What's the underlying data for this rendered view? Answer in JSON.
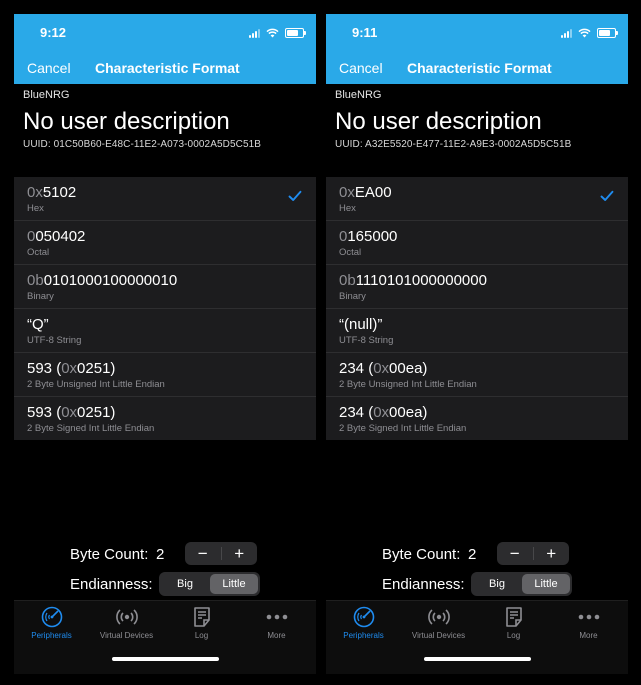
{
  "screens": [
    {
      "time": "9:12",
      "cancel": "Cancel",
      "nav_title": "Characteristic Format",
      "device": "BlueNRG",
      "description": "No user description",
      "uuid": "UUID: 01C50B60-E48C-11E2-A073-0002A5D5C51B",
      "formats": [
        {
          "prefix": "0x",
          "value": "5102",
          "label": "Hex",
          "selected": true
        },
        {
          "prefix": "0",
          "value": "050402",
          "label": "Octal"
        },
        {
          "prefix": "0b",
          "value": "0101000100000010",
          "label": "Binary"
        },
        {
          "prefix": "",
          "value": "“Q”",
          "label": "UTF-8 String"
        },
        {
          "prefix": "",
          "value": "593 (",
          "prefix2": "0x",
          "value2": "0251)",
          "label": "2 Byte Unsigned Int Little Endian"
        },
        {
          "prefix": "",
          "value": "593 (",
          "prefix2": "0x",
          "value2": "0251)",
          "label": "2 Byte Signed Int Little Endian"
        }
      ],
      "byte_count_label": "Byte Count:",
      "byte_count": "2",
      "minus": "−",
      "plus": "+",
      "endianness_label": "Endianness:",
      "endian_options": [
        "Big",
        "Little"
      ],
      "endian_selected": "Little",
      "tabs": [
        {
          "label": "Peripherals",
          "icon": "peripherals-icon",
          "active": true
        },
        {
          "label": "Virtual Devices",
          "icon": "broadcast-icon"
        },
        {
          "label": "Log",
          "icon": "log-icon"
        },
        {
          "label": "More",
          "icon": "more-icon"
        }
      ]
    },
    {
      "time": "9:11",
      "cancel": "Cancel",
      "nav_title": "Characteristic Format",
      "device": "BlueNRG",
      "description": "No user description",
      "uuid": "UUID: A32E5520-E477-11E2-A9E3-0002A5D5C51B",
      "formats": [
        {
          "prefix": "0x",
          "value": "EA00",
          "label": "Hex",
          "selected": true
        },
        {
          "prefix": "0",
          "value": "165000",
          "label": "Octal"
        },
        {
          "prefix": "0b",
          "value": "1110101000000000",
          "label": "Binary"
        },
        {
          "prefix": "",
          "value": "“(null)”",
          "label": "UTF-8 String"
        },
        {
          "prefix": "",
          "value": "234 (",
          "prefix2": "0x",
          "value2": "00ea)",
          "label": "2 Byte Unsigned Int Little Endian"
        },
        {
          "prefix": "",
          "value": "234 (",
          "prefix2": "0x",
          "value2": "00ea)",
          "label": "2 Byte Signed Int Little Endian"
        }
      ],
      "byte_count_label": "Byte Count:",
      "byte_count": "2",
      "minus": "−",
      "plus": "+",
      "endianness_label": "Endianness:",
      "endian_options": [
        "Big",
        "Little"
      ],
      "endian_selected": "Little",
      "tabs": [
        {
          "label": "Peripherals",
          "icon": "peripherals-icon",
          "active": true
        },
        {
          "label": "Virtual Devices",
          "icon": "broadcast-icon"
        },
        {
          "label": "Log",
          "icon": "log-icon"
        },
        {
          "label": "More",
          "icon": "more-icon"
        }
      ]
    }
  ],
  "colors": {
    "nav_bar": "#2aa9e8",
    "accent": "#1f8cf0",
    "list_bg": "#1c1c1e",
    "secondary_text": "#8e8e93"
  }
}
